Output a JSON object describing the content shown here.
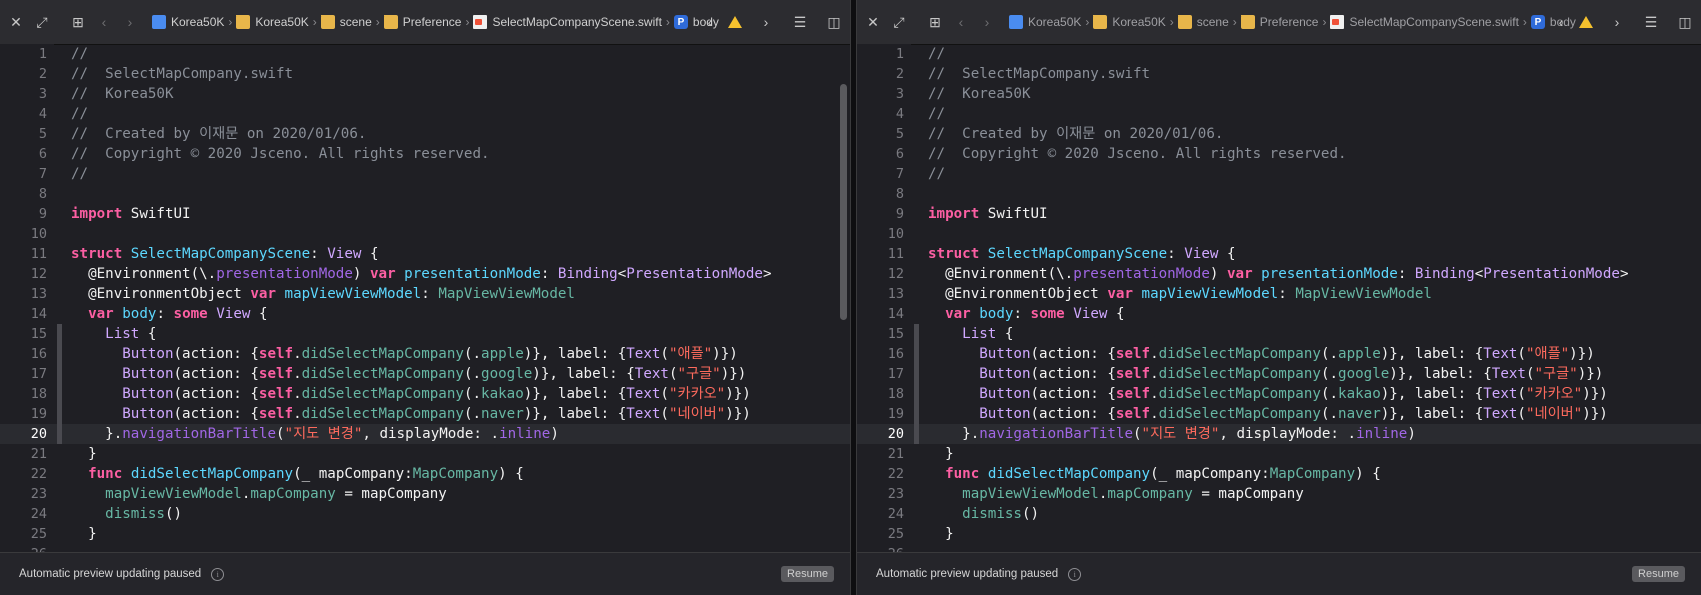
{
  "panes": [
    {
      "id": "left",
      "breadcrumb": [
        {
          "label": "Korea50K",
          "icon": "project-icon"
        },
        {
          "label": "Korea50K",
          "icon": "folder-icon"
        },
        {
          "label": "scene",
          "icon": "folder-icon"
        },
        {
          "label": "Preference",
          "icon": "folder-icon"
        },
        {
          "label": "SelectMapCompanyScene.swift",
          "icon": "swift-file-icon"
        },
        {
          "label": "body",
          "icon": "property-icon"
        }
      ],
      "property_badge": "P",
      "status": {
        "message": "Automatic preview updating paused",
        "info_glyph": "i",
        "resume_label": "Resume"
      }
    },
    {
      "id": "right",
      "breadcrumb": [
        {
          "label": "Korea50K",
          "icon": "project-icon"
        },
        {
          "label": "Korea50K",
          "icon": "folder-icon"
        },
        {
          "label": "scene",
          "icon": "folder-icon"
        },
        {
          "label": "Preference",
          "icon": "folder-icon"
        },
        {
          "label": "SelectMapCompanyScene.swift",
          "icon": "swift-file-icon"
        },
        {
          "label": "body",
          "icon": "property-icon"
        }
      ],
      "property_badge": "P",
      "status": {
        "message": "Automatic preview updating paused",
        "info_glyph": "i",
        "resume_label": "Resume"
      }
    }
  ],
  "current_line": 20,
  "code_lines": [
    [
      [
        "//",
        "comment"
      ]
    ],
    [
      [
        "//  SelectMapCompany.swift",
        "comment"
      ]
    ],
    [
      [
        "//  Korea50K",
        "comment"
      ]
    ],
    [
      [
        "//",
        "comment"
      ]
    ],
    [
      [
        "//  Created by 이재문 on 2020/01/06.",
        "comment"
      ]
    ],
    [
      [
        "//  Copyright © 2020 Jsceno. All rights reserved.",
        "comment"
      ]
    ],
    [
      [
        "//",
        "comment"
      ]
    ],
    [],
    [
      [
        "import",
        "kw"
      ],
      [
        " SwiftUI",
        "plain"
      ]
    ],
    [],
    [
      [
        "struct",
        "kw"
      ],
      [
        " ",
        "plain"
      ],
      [
        "SelectMapCompanyScene",
        "decl"
      ],
      [
        ": ",
        "plain"
      ],
      [
        "View",
        "type"
      ],
      [
        " {",
        "plain"
      ]
    ],
    [
      [
        "  @Environment(\\.",
        "plain"
      ],
      [
        "presentationMode",
        "proj"
      ],
      [
        ") ",
        "plain"
      ],
      [
        "var",
        "kw"
      ],
      [
        " ",
        "plain"
      ],
      [
        "presentationMode",
        "decl"
      ],
      [
        ": ",
        "plain"
      ],
      [
        "Binding",
        "type"
      ],
      [
        "<",
        "plain"
      ],
      [
        "PresentationMode",
        "type"
      ],
      [
        ">",
        "plain"
      ]
    ],
    [
      [
        "  @EnvironmentObject ",
        "plain"
      ],
      [
        "var",
        "kw"
      ],
      [
        " ",
        "plain"
      ],
      [
        "mapViewViewModel",
        "decl"
      ],
      [
        ": ",
        "plain"
      ],
      [
        "MapViewViewModel",
        "prop"
      ]
    ],
    [
      [
        "  ",
        "plain"
      ],
      [
        "var",
        "kw"
      ],
      [
        " ",
        "plain"
      ],
      [
        "body",
        "decl"
      ],
      [
        ": ",
        "plain"
      ],
      [
        "some",
        "kw"
      ],
      [
        " ",
        "plain"
      ],
      [
        "View",
        "type"
      ],
      [
        " {",
        "plain"
      ]
    ],
    [
      [
        "    ",
        "plain"
      ],
      [
        "List",
        "type"
      ],
      [
        " {",
        "plain"
      ]
    ],
    [
      [
        "      ",
        "plain"
      ],
      [
        "Button",
        "type"
      ],
      [
        "(action: {",
        "plain"
      ],
      [
        "self",
        "kw"
      ],
      [
        ".",
        "plain"
      ],
      [
        "didSelectMapCompany",
        "prop"
      ],
      [
        "(.",
        "plain"
      ],
      [
        "apple",
        "prop"
      ],
      [
        ")}, label: {",
        "plain"
      ],
      [
        "Text",
        "type"
      ],
      [
        "(",
        "plain"
      ],
      [
        "\"애플\"",
        "str"
      ],
      [
        ")})",
        "plain"
      ]
    ],
    [
      [
        "      ",
        "plain"
      ],
      [
        "Button",
        "type"
      ],
      [
        "(action: {",
        "plain"
      ],
      [
        "self",
        "kw"
      ],
      [
        ".",
        "plain"
      ],
      [
        "didSelectMapCompany",
        "prop"
      ],
      [
        "(.",
        "plain"
      ],
      [
        "google",
        "prop"
      ],
      [
        ")}, label: {",
        "plain"
      ],
      [
        "Text",
        "type"
      ],
      [
        "(",
        "plain"
      ],
      [
        "\"구글\"",
        "str"
      ],
      [
        ")})",
        "plain"
      ]
    ],
    [
      [
        "      ",
        "plain"
      ],
      [
        "Button",
        "type"
      ],
      [
        "(action: {",
        "plain"
      ],
      [
        "self",
        "kw"
      ],
      [
        ".",
        "plain"
      ],
      [
        "didSelectMapCompany",
        "prop"
      ],
      [
        "(.",
        "plain"
      ],
      [
        "kakao",
        "prop"
      ],
      [
        ")}, label: {",
        "plain"
      ],
      [
        "Text",
        "type"
      ],
      [
        "(",
        "plain"
      ],
      [
        "\"카카오\"",
        "str"
      ],
      [
        ")})",
        "plain"
      ]
    ],
    [
      [
        "      ",
        "plain"
      ],
      [
        "Button",
        "type"
      ],
      [
        "(action: {",
        "plain"
      ],
      [
        "self",
        "kw"
      ],
      [
        ".",
        "plain"
      ],
      [
        "didSelectMapCompany",
        "prop"
      ],
      [
        "(.",
        "plain"
      ],
      [
        "naver",
        "prop"
      ],
      [
        ")}, label: {",
        "plain"
      ],
      [
        "Text",
        "type"
      ],
      [
        "(",
        "plain"
      ],
      [
        "\"네이버\"",
        "str"
      ],
      [
        ")})",
        "plain"
      ]
    ],
    [
      [
        "    }.",
        "plain"
      ],
      [
        "navigationBarTitle",
        "proj"
      ],
      [
        "(",
        "plain"
      ],
      [
        "\"지도 변경\"",
        "str"
      ],
      [
        ", displayMode: .",
        "plain"
      ],
      [
        "inline",
        "proj"
      ],
      [
        ")",
        "plain"
      ]
    ],
    [
      [
        "  }",
        "plain"
      ]
    ],
    [
      [
        "  ",
        "plain"
      ],
      [
        "func",
        "kw"
      ],
      [
        " ",
        "plain"
      ],
      [
        "didSelectMapCompany",
        "decl"
      ],
      [
        "(_ mapCompany:",
        "plain"
      ],
      [
        "MapCompany",
        "prop"
      ],
      [
        ") {",
        "plain"
      ]
    ],
    [
      [
        "    ",
        "plain"
      ],
      [
        "mapViewViewModel",
        "prop"
      ],
      [
        ".",
        "plain"
      ],
      [
        "mapCompany",
        "prop"
      ],
      [
        " = mapCompany",
        "plain"
      ]
    ],
    [
      [
        "    ",
        "plain"
      ],
      [
        "dismiss",
        "prop"
      ],
      [
        "()",
        "plain"
      ]
    ],
    [
      [
        "  }",
        "plain"
      ]
    ],
    [],
    []
  ],
  "colors": {
    "keyword": "#fc5fa3",
    "comment": "#8a8f98",
    "string": "#fc6a5d",
    "type": "#d0a8ff",
    "declaration": "#5dd8ff",
    "project_symbol": "#67b7a4",
    "background": "#1f1f24"
  }
}
